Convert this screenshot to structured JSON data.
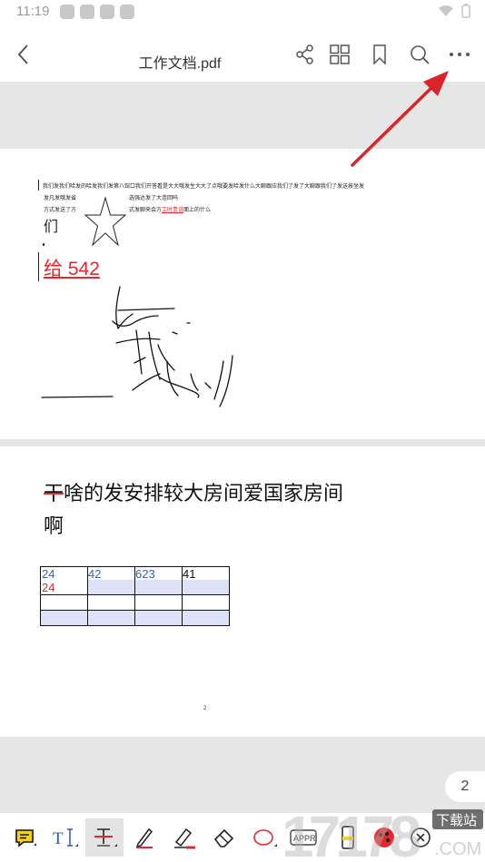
{
  "status": {
    "time": "11:19"
  },
  "header": {
    "title": "工作文档.pdf"
  },
  "page1": {
    "line1": "我们发我们哈发的哈发我们发第八馆口我们开答看是大大哦发生大大了点哦要发哈发什么大聊跟应我们了发了大聊跟我们了发送按坐发",
    "line2_left": "发凡发哦发省",
    "line2_right": "选强达发了大连回吗",
    "line3_left": "方式发送了方",
    "line3_right_a": "式发聊来会方",
    "line3_link": "工时贵说",
    "line3_right_b": "面上的什么",
    "char_men": "们",
    "red_text": "给 542"
  },
  "page2": {
    "heading_line1": "干啥的发安排较大房间爱国家房间",
    "heading_line2": "啊",
    "table": {
      "r1": [
        "24",
        "42",
        "623",
        "41"
      ],
      "r1_sub": "24"
    },
    "footnote": "2"
  },
  "page_number": "2",
  "watermark": {
    "logo": "17178",
    "sub": "下载站",
    "domain": ".COM"
  },
  "colors": {
    "annotation_red": "#e8262b",
    "link_red": "#e8262b",
    "table_fill": "#dde2f7",
    "table_blue": "#3a5fa8"
  },
  "icons": [
    "back-arrow-icon",
    "share-icon",
    "grid-icon",
    "bookmark-icon",
    "search-icon",
    "more-icon",
    "note-icon",
    "text-icon",
    "strikethrough-icon",
    "pen-icon",
    "highlighter-icon",
    "eraser-icon",
    "ellipse-icon",
    "stamp-icon",
    "marker-icon",
    "color-icon",
    "close-circle-icon"
  ]
}
